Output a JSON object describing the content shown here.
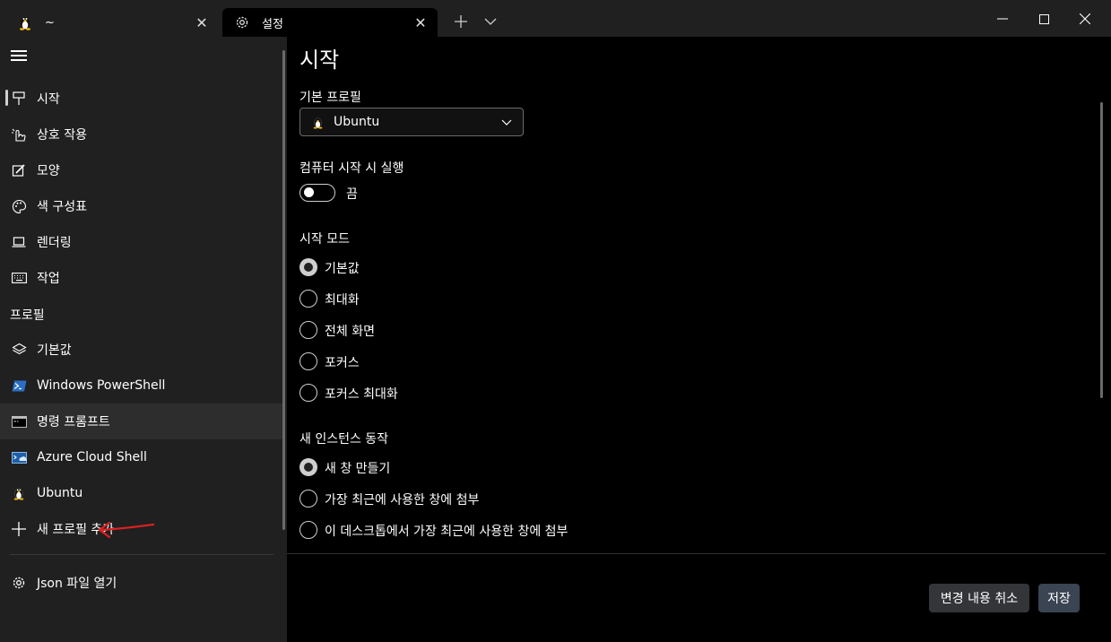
{
  "window": {
    "tabs": [
      {
        "title": "~",
        "icon": "tux-icon",
        "active": false
      },
      {
        "title": "설정",
        "icon": "gear-icon",
        "active": true
      }
    ],
    "new_tab_glyph": "+",
    "close_glyph": "✕"
  },
  "sidebar": {
    "items": [
      {
        "label": "시작",
        "icon": "startup-icon"
      },
      {
        "label": "상호 작용",
        "icon": "interaction-icon"
      },
      {
        "label": "모양",
        "icon": "appearance-icon"
      },
      {
        "label": "색 구성표",
        "icon": "palette-icon"
      },
      {
        "label": "렌더링",
        "icon": "rendering-icon"
      },
      {
        "label": "작업",
        "icon": "keyboard-icon"
      }
    ],
    "profiles_header": "프로필",
    "profiles": [
      {
        "label": "기본값",
        "icon": "layers-icon"
      },
      {
        "label": "Windows PowerShell",
        "icon": "powershell-icon"
      },
      {
        "label": "명령 프롬프트",
        "icon": "cmd-icon"
      },
      {
        "label": "Azure Cloud Shell",
        "icon": "azure-icon"
      },
      {
        "label": "Ubuntu",
        "icon": "tux-icon"
      },
      {
        "label": "새 프로필 추가",
        "icon": "plus-icon"
      }
    ],
    "open_json": "Json 파일 열기"
  },
  "main": {
    "title": "시작",
    "default_profile": {
      "label": "기본 프로필",
      "value": "Ubuntu"
    },
    "launch_on_startup": {
      "label": "컴퓨터 시작 시 실행",
      "state": "끔"
    },
    "launch_mode": {
      "label": "시작 모드",
      "options": [
        "기본값",
        "최대화",
        "전체 화면",
        "포커스",
        "포커스 최대화"
      ],
      "selected": 0
    },
    "new_instance": {
      "label": "새 인스턴스 동작",
      "options": [
        "새 창 만들기",
        "가장 최근에 사용한 창에 첨부",
        "이 데스크톱에서 가장 최근에 사용한 창에 첨부"
      ],
      "selected": 0
    },
    "discard_button": "변경 내용 취소",
    "save_button": "저장"
  },
  "colors": {
    "sidebar_bg": "#202020",
    "main_bg": "#000000",
    "annotation_arrow": "#e02020"
  }
}
